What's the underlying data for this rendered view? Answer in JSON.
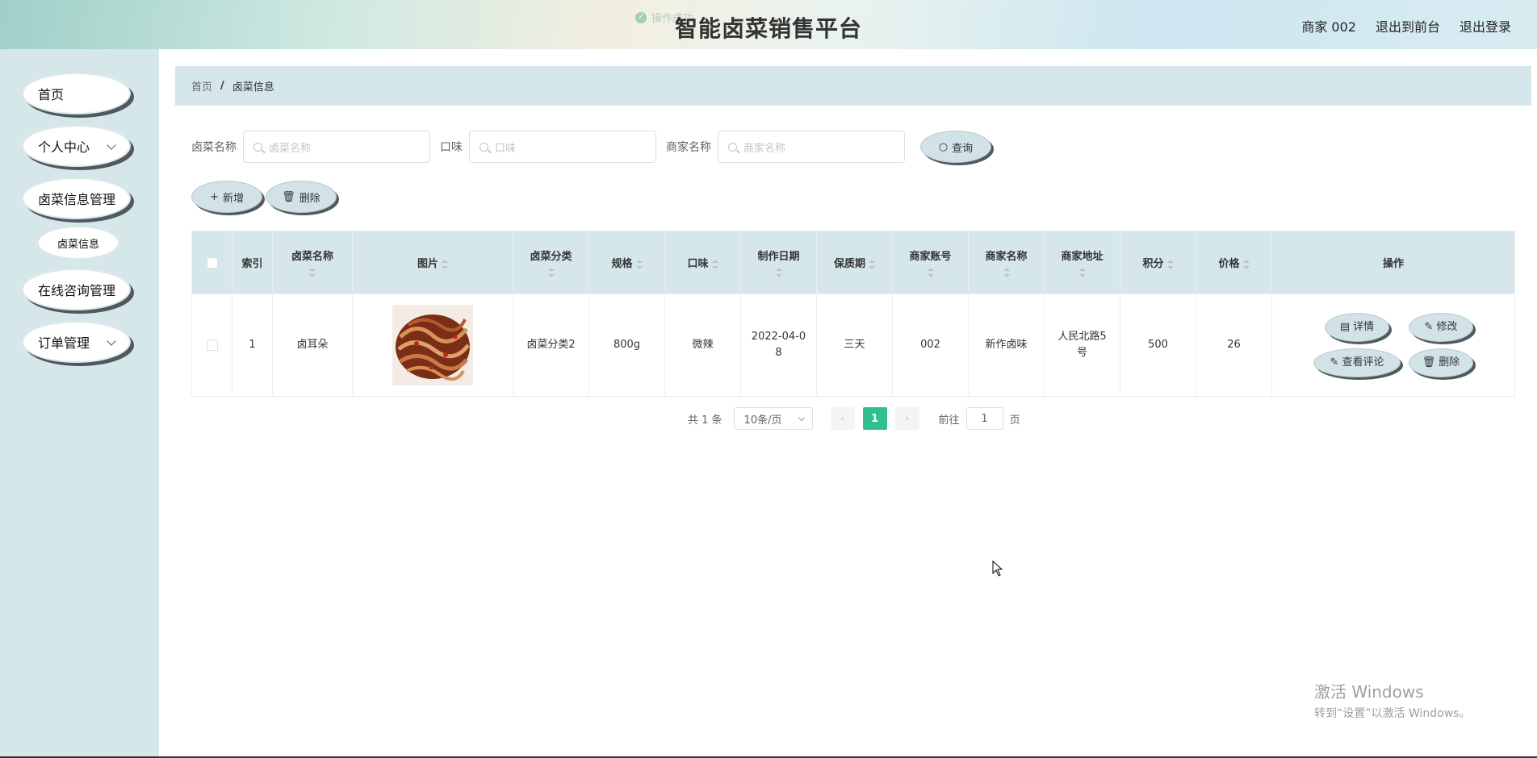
{
  "header": {
    "toast": "操作成功",
    "title": "智能卤菜销售平台",
    "user": "商家 002",
    "back_to_front": "退出到前台",
    "logout": "退出登录"
  },
  "sidebar": {
    "items": [
      {
        "label": "首页"
      },
      {
        "label": "个人中心"
      },
      {
        "label": "卤菜信息管理"
      },
      {
        "label": "卤菜信息"
      },
      {
        "label": "在线咨询管理"
      },
      {
        "label": "订单管理"
      }
    ]
  },
  "breadcrumb": {
    "home": "首页",
    "sep": "/",
    "current": "卤菜信息"
  },
  "search": {
    "name_label": "卤菜名称",
    "name_placeholder": "卤菜名称",
    "taste_label": "口味",
    "taste_placeholder": "口味",
    "merchant_label": "商家名称",
    "merchant_placeholder": "商家名称",
    "query_button": "查询"
  },
  "actions": {
    "add": "新增",
    "delete": "删除"
  },
  "table": {
    "headers": [
      "索引",
      "卤菜名称",
      "图片",
      "卤菜分类",
      "规格",
      "口味",
      "制作日期",
      "保质期",
      "商家账号",
      "商家名称",
      "商家地址",
      "积分",
      "价格",
      "操作"
    ],
    "rows": [
      {
        "index": "1",
        "name": "卤耳朵",
        "category": "卤菜分类2",
        "spec": "800g",
        "taste": "微辣",
        "date_a": "2022-04-0",
        "date_b": "8",
        "shelf_life": "三天",
        "merchant_account": "002",
        "merchant_name": "新作卤味",
        "address_a": "人民北路5",
        "address_b": "号",
        "points": "500",
        "price": "26"
      }
    ],
    "ops": {
      "detail": "详情",
      "edit": "修改",
      "reviews": "查看评论",
      "delete": "删除"
    }
  },
  "pagination": {
    "total": "共 1 条",
    "page_size": "10条/页",
    "current_page": "1",
    "goto_label": "前往",
    "goto_value": "1",
    "page_unit": "页"
  },
  "watermark": {
    "line1": "激活 Windows",
    "line2": "转到“设置”以激活 Windows。"
  }
}
